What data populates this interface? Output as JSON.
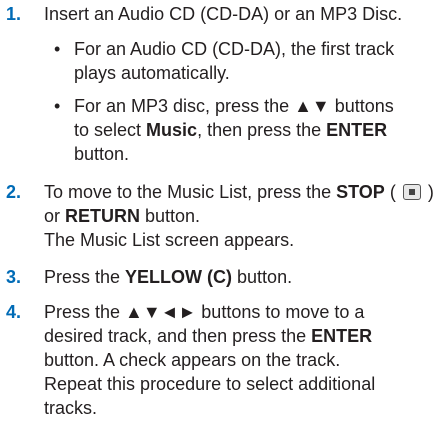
{
  "steps": [
    {
      "number": "1.",
      "text": "Insert an Audio CD (CD-DA) or an MP3 Disc.",
      "bullets": [
        {
          "line1": "For an Audio CD (CD-DA), the first track",
          "line2": "plays automatically."
        },
        {
          "line1": "For an MP3 disc, press the ▲▼ buttons",
          "line2_pre": "to select ",
          "line2_bold": "Music",
          "line2_mid": ", then press the ",
          "line2_bold2": "ENTER",
          "line3": "button."
        }
      ]
    },
    {
      "number": "2.",
      "line1_pre": "To move to the Music List, press the ",
      "line1_bold": "STOP",
      "line1_paren_open": " ( ",
      "line1_paren_close": " )",
      "line2_pre": "or ",
      "line2_bold": "RETURN",
      "line2_post": " button.",
      "line3": "The Music List screen appears."
    },
    {
      "number": "3.",
      "pre": "Press the ",
      "bold": "YELLOW (C)",
      "post": " button."
    },
    {
      "number": "4.",
      "line1": "Press the ▲▼◄► buttons to move to a",
      "line2_pre": "desired track, and then press the ",
      "line2_bold": "ENTER",
      "line3": "button. A check appears on the track.",
      "line4": "Repeat this procedure to select additional",
      "line5": "tracks."
    }
  ],
  "bullet_char": "•"
}
